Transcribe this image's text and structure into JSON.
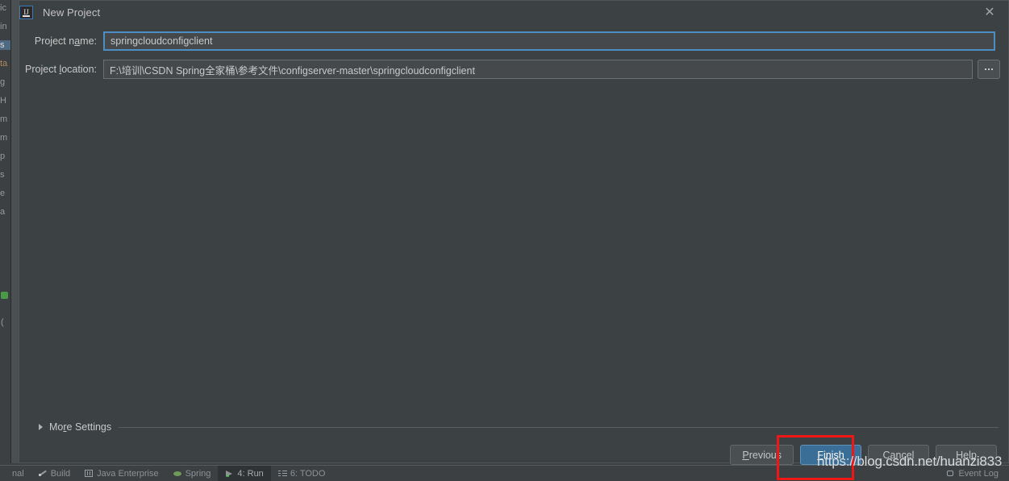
{
  "ide": {
    "left_strip_letters": [
      {
        "text": "ic",
        "warm": false,
        "selected": false
      },
      {
        "text": "in",
        "warm": false,
        "selected": false
      },
      {
        "text": "s",
        "warm": false,
        "selected": true
      },
      {
        "text": "ta",
        "warm": true,
        "selected": false
      },
      {
        "text": "g",
        "warm": false,
        "selected": false
      },
      {
        "text": "H",
        "warm": false,
        "selected": false
      },
      {
        "text": "m",
        "warm": false,
        "selected": false
      },
      {
        "text": "m",
        "warm": false,
        "selected": false
      },
      {
        "text": "p",
        "warm": false,
        "selected": false
      },
      {
        "text": "s",
        "warm": false,
        "selected": false
      },
      {
        "text": "e",
        "warm": false,
        "selected": false
      },
      {
        "text": "a",
        "warm": false,
        "selected": false
      }
    ],
    "strip_paren": "(",
    "status_bar": {
      "items": [
        {
          "label": "nal",
          "icon": "terminal-icon",
          "active": false
        },
        {
          "label": "Build",
          "icon": "build-icon",
          "active": false
        },
        {
          "label": "Java Enterprise",
          "icon": "java-enterprise-icon",
          "active": false
        },
        {
          "label": "Spring",
          "icon": "spring-icon",
          "active": false
        },
        {
          "label": "4: Run",
          "icon": "run-icon",
          "active": true
        },
        {
          "label": "6: TODO",
          "icon": "todo-icon",
          "active": false
        }
      ],
      "event_log": {
        "label": "Event Log",
        "icon": "event-log-icon"
      }
    }
  },
  "dialog": {
    "title": "New Project",
    "icon": "intellij-idea-icon",
    "close_icon": "close-icon",
    "fields": {
      "project_name": {
        "label_prefix": "Project n",
        "label_mnemonic": "a",
        "label_suffix": "me:",
        "value": "springcloudconfigclient",
        "placeholder": ""
      },
      "project_location": {
        "label_prefix": "Project ",
        "label_mnemonic": "l",
        "label_suffix": "ocation:",
        "value": "F:\\培训\\CSDN Spring全家桶\\参考文件\\configserver-master\\springcloudconfigclient",
        "placeholder": "",
        "browse_label": "...",
        "browse_icon": "ellipsis-icon"
      }
    },
    "more_settings": {
      "label_prefix": "Mo",
      "label_mnemonic": "r",
      "label_suffix": "e Settings",
      "expand_icon": "chevron-right-icon",
      "expanded": false
    },
    "buttons": [
      {
        "name": "previous",
        "prefix": "",
        "mnemonic": "P",
        "suffix": "revious",
        "primary": false
      },
      {
        "name": "finish",
        "prefix": "",
        "mnemonic": "F",
        "suffix": "inish",
        "primary": true
      },
      {
        "name": "cancel",
        "prefix": "Cancel",
        "mnemonic": "",
        "suffix": "",
        "primary": false
      },
      {
        "name": "help",
        "prefix": "Help",
        "mnemonic": "",
        "suffix": "",
        "primary": false
      }
    ]
  },
  "annotation": {
    "shape": "rectangle",
    "color": "#ef1616",
    "target": "finish-button"
  },
  "watermark": {
    "text": "https://blog.csdn.net/huanzi833"
  },
  "colors": {
    "dialog_bg": "#3c4143",
    "input_bg": "#45494b",
    "focus_border": "#4e8ec2",
    "primary_button": "#3a6e96",
    "annotation_red": "#ef1616",
    "text": "#c8c8c8"
  }
}
